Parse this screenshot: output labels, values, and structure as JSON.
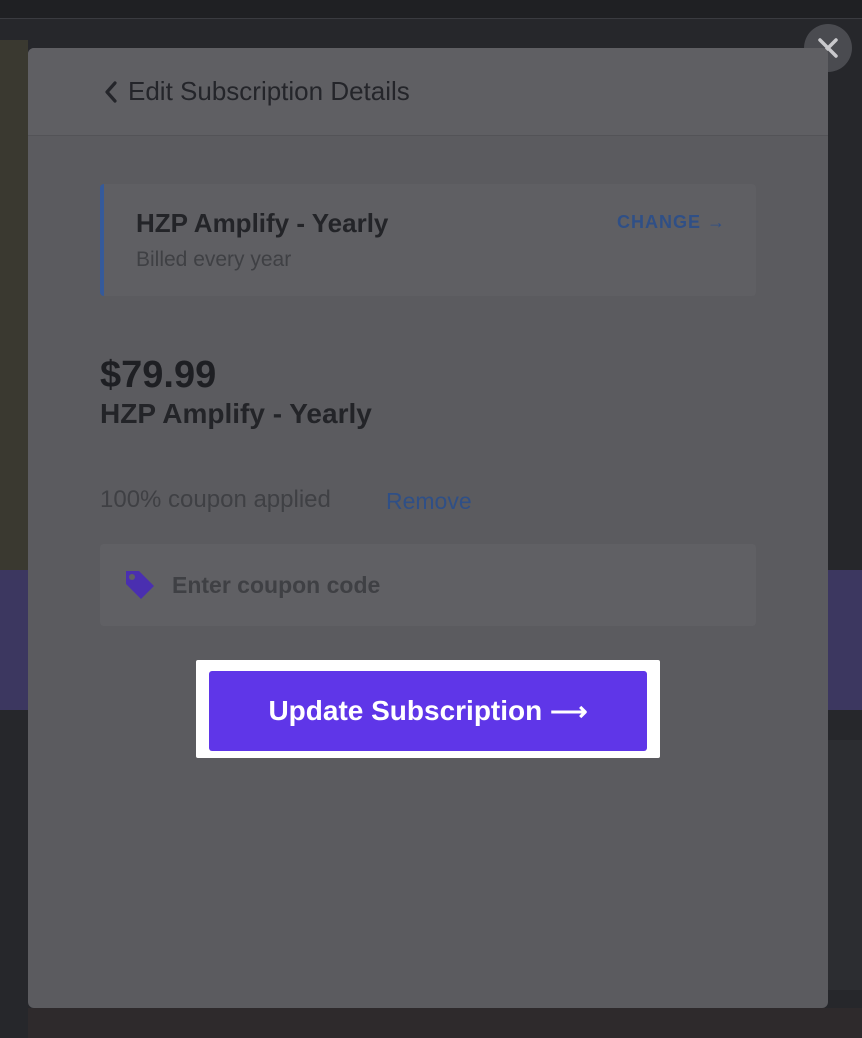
{
  "header": {
    "title": "Edit Subscription Details"
  },
  "plan_card": {
    "name": "HZP Amplify - Yearly",
    "billing": "Billed every year",
    "change_label": "CHANGE →"
  },
  "summary": {
    "price": "$79.99",
    "plan_name": "HZP Amplify - Yearly"
  },
  "coupon": {
    "status": "100% coupon applied",
    "remove_label": "Remove",
    "placeholder": "Enter coupon code",
    "icon": "tag-icon"
  },
  "cta": {
    "label": "Update Subscription",
    "arrow": "⟶"
  },
  "colors": {
    "accent": "#5f36e8",
    "link": "#2f4f86",
    "card_border": "#355a9a"
  }
}
